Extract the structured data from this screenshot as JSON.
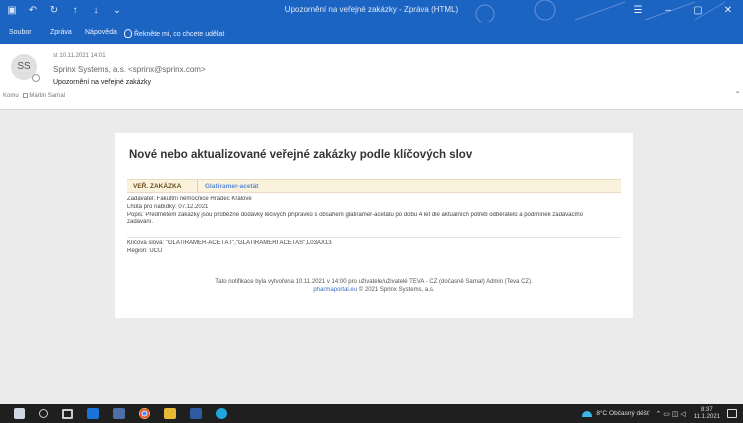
{
  "window": {
    "title": "Upozornění na veřejné zakázky - Zpráva (HTML)",
    "controls": [
      "restore-ribbon",
      "minimize",
      "maximize",
      "close"
    ]
  },
  "menu": {
    "items": [
      "Soubor",
      "Zpráva",
      "Nápověda"
    ],
    "tell_me": "Řekněte mi, co chcete udělat"
  },
  "header": {
    "avatar_initials": "SS",
    "date": "st 10.11.2021 14:01",
    "sender": "Sprinx Systems, a.s. <sprinx@sprinx.com>",
    "subject": "Upozornění na veřejné zakázky",
    "forward_label": "Komu",
    "forward_checkbox": "Martin Sarnal"
  },
  "email": {
    "heading": "Nové nebo aktualizované veřejné zakázky podle klíčových slov",
    "table": {
      "type_label": "VEŘ. ZAKÁZKA",
      "name_label": "Glatiramer-acetát"
    },
    "details": [
      "Zadavatel: Fakultní nemocnice Hradec Králové",
      "Lhůta pro nabídky: 07.12.2021",
      "Popis: Předmětem zakázky jsou průběžné dodávky léčivých přípravků s obsahem glatiramer-acetátu po dobu 4 let dle aktuálních potřeb odběratelů a podmínek zadávacího",
      "zadávání."
    ],
    "keywords": [
      "Klíčová slova: \"GLATIRAMER-ACETÁT\",\"GLATIRAMERI ACETAS\",L03AX13",
      "Region: ÚCU"
    ],
    "footer_text": "Tato notifikace byla vytvořena 10.11.2021 v 14:00 pro uživatele/uživatelé TEVA - CZ (dočasně Sarnal) Admin (Teva CZ).",
    "footer_link": "pharmaportal.eu",
    "footer_copy": "© 2021 Sprinx Systems, a.s."
  },
  "taskbar": {
    "weather": "8°C Občasný déšť",
    "time": "8:37",
    "date": "11.1.2021"
  },
  "colors": {
    "titlebar": "#1c64c2",
    "table_head_bg": "#fbf2dd",
    "link": "#3b6fc9"
  }
}
